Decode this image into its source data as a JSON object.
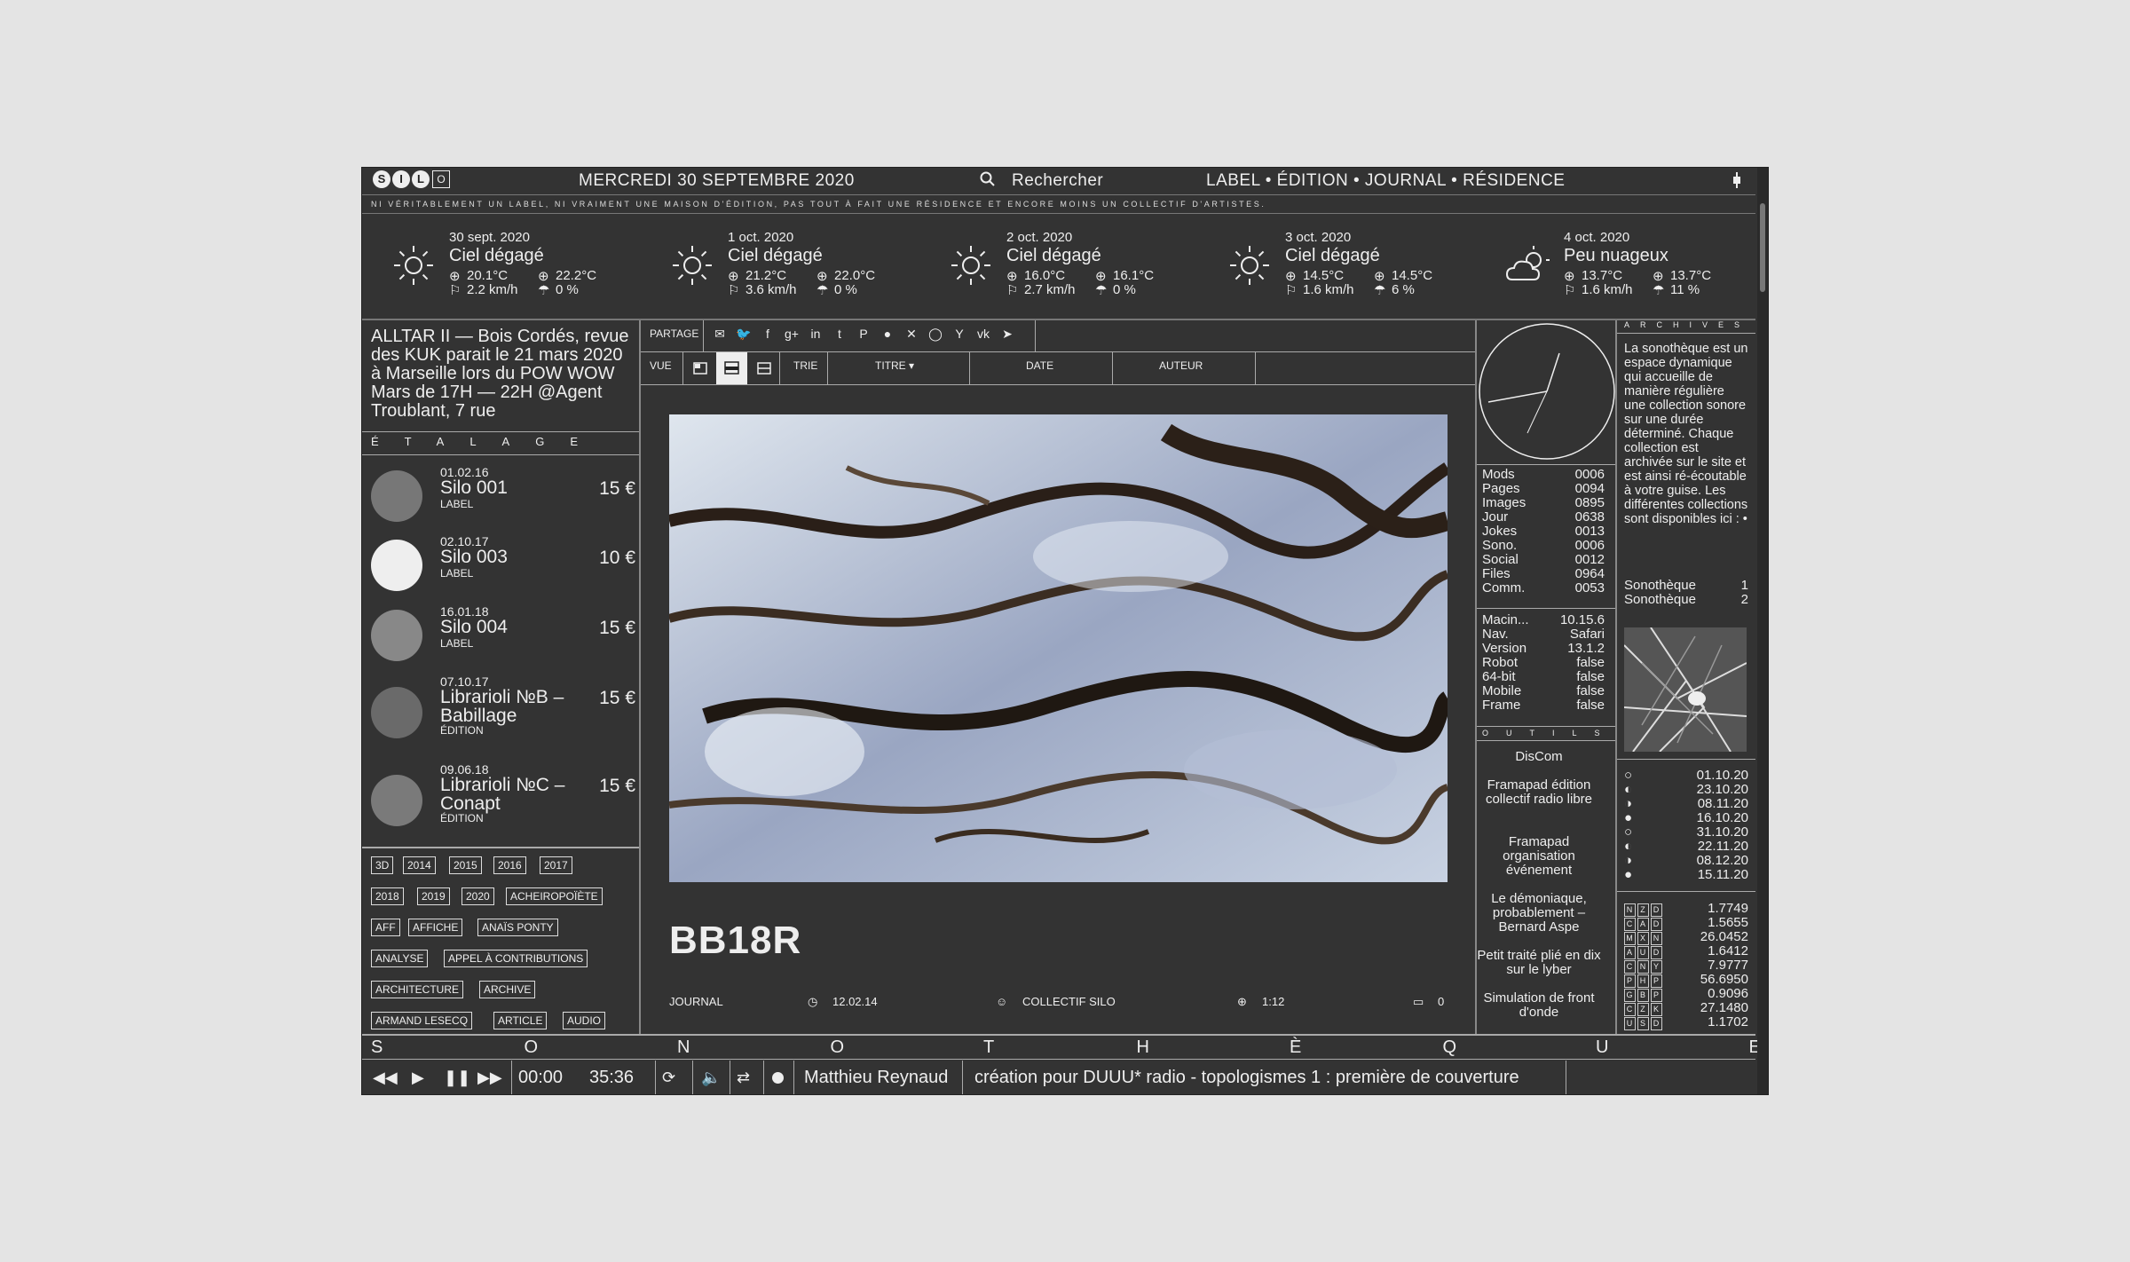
{
  "header": {
    "logo_letters": [
      "S",
      "I",
      "L",
      "O"
    ],
    "date": "MERCREDI 30 SEPTEMBRE 2020",
    "search_label": "Rechercher",
    "nav": "LABEL • ÉDITION • JOURNAL • RÉSIDENCE",
    "tagline": "NI VÉRITABLEMENT UN LABEL, NI VRAIMENT UNE MAISON D'ÉDITION, PAS TOUT À FAIT UNE RÉSIDENCE ET ENCORE MOINS UN COLLECTIF D'ARTISTES."
  },
  "weather": [
    {
      "date": "30 sept. 2020",
      "cond": "Ciel dégagé",
      "icon": "sun-icon",
      "tmin": "20.1°C",
      "tmax": "22.2°C",
      "wind": "2.2 km/h",
      "rain": "0 %"
    },
    {
      "date": "1 oct. 2020",
      "cond": "Ciel dégagé",
      "icon": "sun-icon",
      "tmin": "21.2°C",
      "tmax": "22.0°C",
      "wind": "3.6 km/h",
      "rain": "0 %"
    },
    {
      "date": "2 oct. 2020",
      "cond": "Ciel dégagé",
      "icon": "sun-icon",
      "tmin": "16.0°C",
      "tmax": "16.1°C",
      "wind": "2.7 km/h",
      "rain": "0 %"
    },
    {
      "date": "3 oct. 2020",
      "cond": "Ciel dégagé",
      "icon": "sun-icon",
      "tmin": "14.5°C",
      "tmax": "14.5°C",
      "wind": "1.6 km/h",
      "rain": "6 %"
    },
    {
      "date": "4 oct. 2020",
      "cond": "Peu nuageux",
      "icon": "cloud-sun-icon",
      "tmin": "13.7°C",
      "tmax": "13.7°C",
      "wind": "1.6 km/h",
      "rain": "11 %"
    }
  ],
  "news": "ALLTAR II — Bois Cordés, revue des KUK parait le 21 mars 2020 à Marseille lors du POW WOW Mars de 17H — 22H @Agent Troublant, 7 rue",
  "etalage_label": "ÉTALAGE",
  "products": [
    {
      "date": "01.02.16",
      "name": "Silo 001",
      "type": "LABEL",
      "price": "15 €"
    },
    {
      "date": "02.10.17",
      "name": "Silo 003",
      "type": "LABEL",
      "price": "10 €"
    },
    {
      "date": "16.01.18",
      "name": "Silo 004",
      "type": "LABEL",
      "price": "15 €"
    },
    {
      "date": "07.10.17",
      "name": "Librarioli №B – Babillage",
      "type": "ÉDITION",
      "price": "15 €"
    },
    {
      "date": "09.06.18",
      "name": "Librarioli №C – Conapt",
      "type": "ÉDITION",
      "price": "15 €"
    }
  ],
  "tags": [
    "3D",
    "2014",
    "2015",
    "2016",
    "2017",
    "2018",
    "2019",
    "2020",
    "ACHEIROPOÏÈTE",
    "AFF",
    "AFFICHE",
    "ANAÏS PONTY",
    "ANALYSE",
    "APPEL À CONTRIBUTIONS",
    "ARCHITECTURE",
    "ARCHIVE",
    "ARMAND LESECQ",
    "ARTICLE",
    "AUDIO"
  ],
  "toolbar": {
    "share_label": "PARTAGE",
    "share_icons": [
      "✉",
      "🐦",
      "f",
      "g+",
      "in",
      "t",
      "P",
      "●",
      "✕",
      "◯",
      "Y",
      "vk",
      "➤"
    ],
    "view_label": "VUE",
    "sort_label": "TRIE",
    "sort_title": "TITRE ▾",
    "sort_date": "DATE",
    "sort_author": "AUTEUR"
  },
  "article": {
    "title": "BB18R",
    "category": "JOURNAL",
    "date": "12.02.14",
    "author": "COLLECTIF SILO",
    "ratio": "1:12",
    "comments": "0"
  },
  "stats": [
    {
      "k": "Mods",
      "v": "0006"
    },
    {
      "k": "Pages",
      "v": "0094"
    },
    {
      "k": "Images",
      "v": "0895"
    },
    {
      "k": "Jour",
      "v": "0638"
    },
    {
      "k": "Jokes",
      "v": "0013"
    },
    {
      "k": "Sono.",
      "v": "0006"
    },
    {
      "k": "Social",
      "v": "0012"
    },
    {
      "k": "Files",
      "v": "0964"
    },
    {
      "k": "Comm.",
      "v": "0053"
    }
  ],
  "system": [
    {
      "k": "Macin...",
      "v": "10.15.6"
    },
    {
      "k": "Nav.",
      "v": "Safari"
    },
    {
      "k": "Version",
      "v": "13.1.2"
    },
    {
      "k": "Robot",
      "v": "false"
    },
    {
      "k": "64-bit",
      "v": "false"
    },
    {
      "k": "Mobile",
      "v": "false"
    },
    {
      "k": "Frame",
      "v": "false"
    }
  ],
  "outils_label": "OUTILS",
  "tools": [
    "DisCom",
    "Framapad édition collectif radio libre",
    "Framapad organisation événement",
    "Le démoniaque, probablement – Bernard Aspe",
    "Petit traité plié en dix sur le lyber",
    "Simulation de front d'onde"
  ],
  "archives_label": "ARCHIVES",
  "archives_text": "La sonothèque est un espace dynamique qui accueille de manière régulière une collection sonore sur une durée déterminé. Chaque collection est archivée sur le site et est ainsi ré-écoutable à votre guise. Les différentes collections sont disponibles ici : •",
  "sonotheques": [
    {
      "name": "Sonothèque",
      "n": "1"
    },
    {
      "name": "Sonothèque",
      "n": "2"
    }
  ],
  "moon_dates": [
    "01.10.20",
    "23.10.20",
    "08.11.20",
    "16.10.20",
    "31.10.20",
    "22.11.20",
    "08.12.20",
    "15.11.20"
  ],
  "currencies": [
    {
      "code": "NZD",
      "val": "1.7749"
    },
    {
      "code": "CAD",
      "val": "1.5655"
    },
    {
      "code": "MXN",
      "val": "26.0452"
    },
    {
      "code": "AUD",
      "val": "1.6412"
    },
    {
      "code": "CNY",
      "val": "7.9777"
    },
    {
      "code": "PHP",
      "val": "56.6950"
    },
    {
      "code": "GBP",
      "val": "0.9096"
    },
    {
      "code": "CZK",
      "val": "27.1480"
    },
    {
      "code": "USD",
      "val": "1.1702"
    }
  ],
  "sonotheque_bar": [
    "S",
    "O",
    "N",
    "O",
    "T",
    "H",
    "È",
    "Q",
    "U",
    "E"
  ],
  "player": {
    "time_current": "00:00",
    "time_total": "35:36",
    "artist": "Matthieu Reynaud",
    "track": "création pour DUUU* radio - topologismes 1 : première de couverture"
  }
}
